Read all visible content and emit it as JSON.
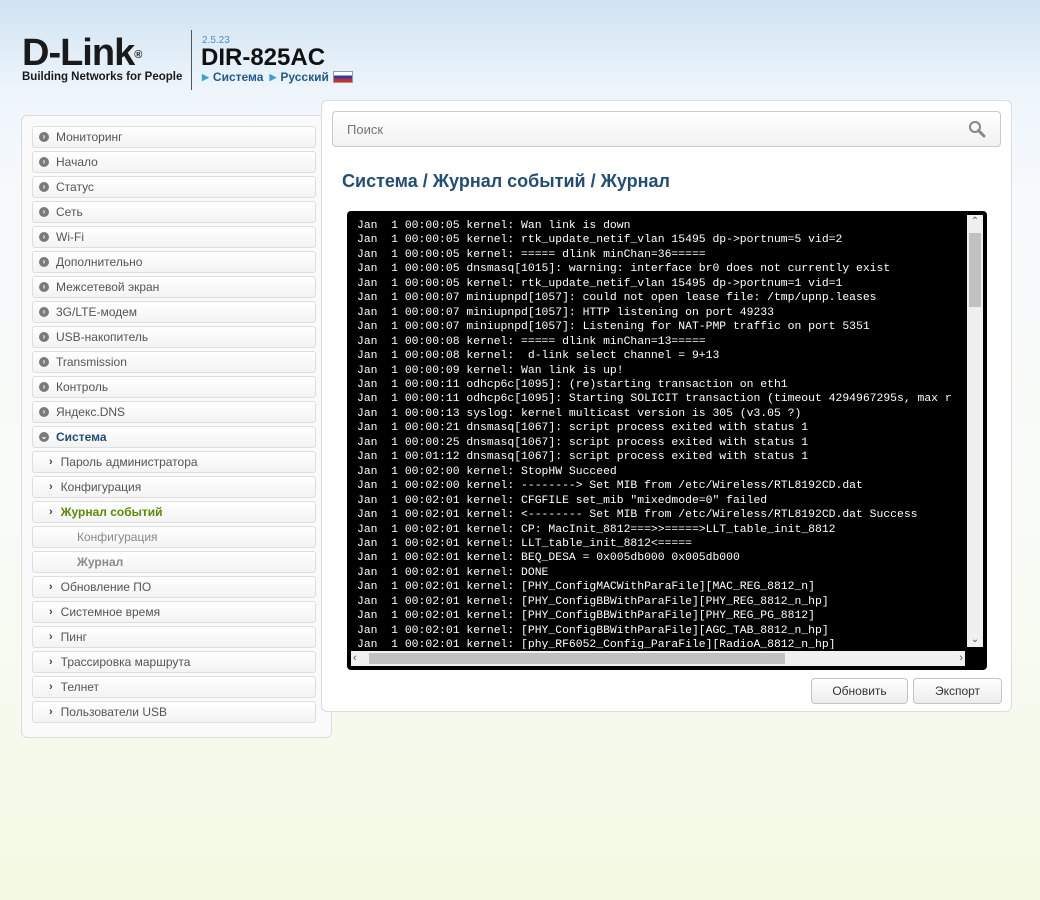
{
  "header": {
    "logo_text": "D-Link",
    "logo_tagline": "Building Networks for People",
    "firmware_version": "2.5.23",
    "model": "DIR-825AC",
    "breadcrumb_system": "Система",
    "breadcrumb_language": "Русский"
  },
  "sidebar": {
    "items": [
      {
        "label": "Мониторинг"
      },
      {
        "label": "Начало"
      },
      {
        "label": "Статус"
      },
      {
        "label": "Сеть"
      },
      {
        "label": "Wi-Fi"
      },
      {
        "label": "Дополнительно"
      },
      {
        "label": "Межсетевой экран"
      },
      {
        "label": "3G/LTE-модем"
      },
      {
        "label": "USB-накопитель"
      },
      {
        "label": "Transmission"
      },
      {
        "label": "Контроль"
      },
      {
        "label": "Яндекс.DNS"
      },
      {
        "label": "Система"
      }
    ],
    "sub_items": [
      {
        "label": "Пароль администратора"
      },
      {
        "label": "Конфигурация"
      },
      {
        "label": "Журнал событий"
      }
    ],
    "subsub_items": [
      {
        "label": "Конфигурация"
      },
      {
        "label": "Журнал"
      }
    ],
    "sub_items_after": [
      {
        "label": "Обновление ПО"
      },
      {
        "label": "Системное время"
      },
      {
        "label": "Пинг"
      },
      {
        "label": "Трассировка маршрута"
      },
      {
        "label": "Телнет"
      },
      {
        "label": "Пользователи USB"
      }
    ]
  },
  "search": {
    "placeholder": "Поиск"
  },
  "page": {
    "title_part1": "Система /",
    "title_part2": "Журнал событий /",
    "title_part3": "Журнал"
  },
  "log": {
    "lines": [
      "Jan  1 00:00:05 kernel: Wan link is down",
      "Jan  1 00:00:05 kernel: rtk_update_netif_vlan 15495 dp->portnum=5 vid=2",
      "Jan  1 00:00:05 kernel: ===== dlink minChan=36=====",
      "Jan  1 00:00:05 dnsmasq[1015]: warning: interface br0 does not currently exist",
      "Jan  1 00:00:05 kernel: rtk_update_netif_vlan 15495 dp->portnum=1 vid=1",
      "Jan  1 00:00:07 miniupnpd[1057]: could not open lease file: /tmp/upnp.leases",
      "Jan  1 00:00:07 miniupnpd[1057]: HTTP listening on port 49233",
      "Jan  1 00:00:07 miniupnpd[1057]: Listening for NAT-PMP traffic on port 5351",
      "Jan  1 00:00:08 kernel: ===== dlink minChan=13=====",
      "Jan  1 00:00:08 kernel:  d-link select channel = 9+13",
      "Jan  1 00:00:09 kernel: Wan link is up!",
      "Jan  1 00:00:11 odhcp6c[1095]: (re)starting transaction on eth1",
      "Jan  1 00:00:11 odhcp6c[1095]: Starting SOLICIT transaction (timeout 4294967295s, max r",
      "Jan  1 00:00:13 syslog: kernel multicast version is 305 (v3.05 ?)",
      "Jan  1 00:00:21 dnsmasq[1067]: script process exited with status 1",
      "Jan  1 00:00:25 dnsmasq[1067]: script process exited with status 1",
      "Jan  1 00:01:12 dnsmasq[1067]: script process exited with status 1",
      "Jan  1 00:02:00 kernel: StopHW Succeed",
      "Jan  1 00:02:00 kernel: --------> Set MIB from /etc/Wireless/RTL8192CD.dat",
      "Jan  1 00:02:01 kernel: CFGFILE set_mib \"mixedmode=0\" failed",
      "Jan  1 00:02:01 kernel: <-------- Set MIB from /etc/Wireless/RTL8192CD.dat Success",
      "Jan  1 00:02:01 kernel: CP: MacInit_8812===>>=====>LLT_table_init_8812",
      "Jan  1 00:02:01 kernel: LLT_table_init_8812<=====",
      "Jan  1 00:02:01 kernel: BEQ_DESA = 0x005db000 0x005db000",
      "Jan  1 00:02:01 kernel: DONE",
      "Jan  1 00:02:01 kernel: [PHY_ConfigMACWithParaFile][MAC_REG_8812_n]",
      "Jan  1 00:02:01 kernel: [PHY_ConfigBBWithParaFile][PHY_REG_8812_n_hp]",
      "Jan  1 00:02:01 kernel: [PHY_ConfigBBWithParaFile][PHY_REG_PG_8812]",
      "Jan  1 00:02:01 kernel: [PHY_ConfigBBWithParaFile][AGC_TAB_8812_n_hp]",
      "Jan  1 00:02:01 kernel: [phy_RF6052_Config_ParaFile][RadioA_8812_n_hp]"
    ]
  },
  "buttons": {
    "refresh": "Обновить",
    "export": "Экспорт"
  }
}
